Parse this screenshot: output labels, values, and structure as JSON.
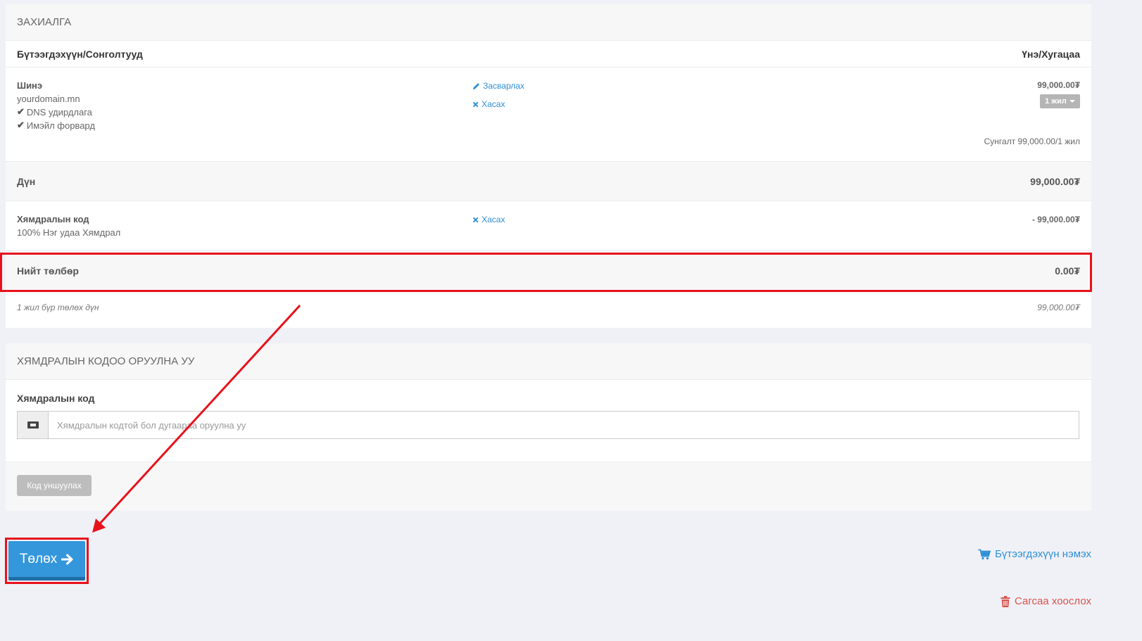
{
  "order": {
    "heading": "ЗАХИАЛГА",
    "col_product": "Бүтээгдэхүүн/Сонголтууд",
    "col_price": "Үнэ/Хугацаа",
    "item": {
      "name": "Шинэ",
      "domain": "yourdomain.mn",
      "addons": [
        "DNS удирдлага",
        "Имэйл форвард"
      ],
      "edit_label": "Засварлах",
      "remove_label": "Хасах",
      "price": "99,000.00₮",
      "period": "1 жил",
      "renewal": "Сунгалт 99,000.00/1 жил"
    },
    "subtotal_label": "Дүн",
    "subtotal_value": "99,000.00₮",
    "discount": {
      "title": "Хямдралын код",
      "description": "100% Нэг удаа Хямдрал",
      "remove_label": "Хасах",
      "amount": "- 99,000.00₮"
    },
    "total_label": "Нийт төлбөр",
    "total_value": "0.00₮",
    "recurring_label": "1 жил бүр төлөх дүн",
    "recurring_value": "99,000.00₮"
  },
  "promo": {
    "heading": "ХЯМДРАЛЫН КОДОО ОРУУЛНА УУ",
    "label": "Хямдралын код",
    "placeholder": "Хямдралын кодтой бол дугаараа оруулна уу",
    "value": "",
    "validate_label": "Код уншуулах"
  },
  "actions": {
    "checkout_label": "Төлөх",
    "continue_label": "Бүтээгдэхүүн нэмэх",
    "empty_label": "Сагсаа хоослох"
  },
  "colors": {
    "accent": "#3497db",
    "link": "#2f8fd6",
    "danger": "#d9534f",
    "annotation": "#e8121c"
  },
  "icons": {
    "edit": "pencil-icon",
    "remove": "times-icon",
    "check": "check-icon",
    "ticket": "ticket-icon",
    "checkout": "arrow-right-icon",
    "continue": "cart-plus-icon",
    "empty": "trash-icon"
  }
}
